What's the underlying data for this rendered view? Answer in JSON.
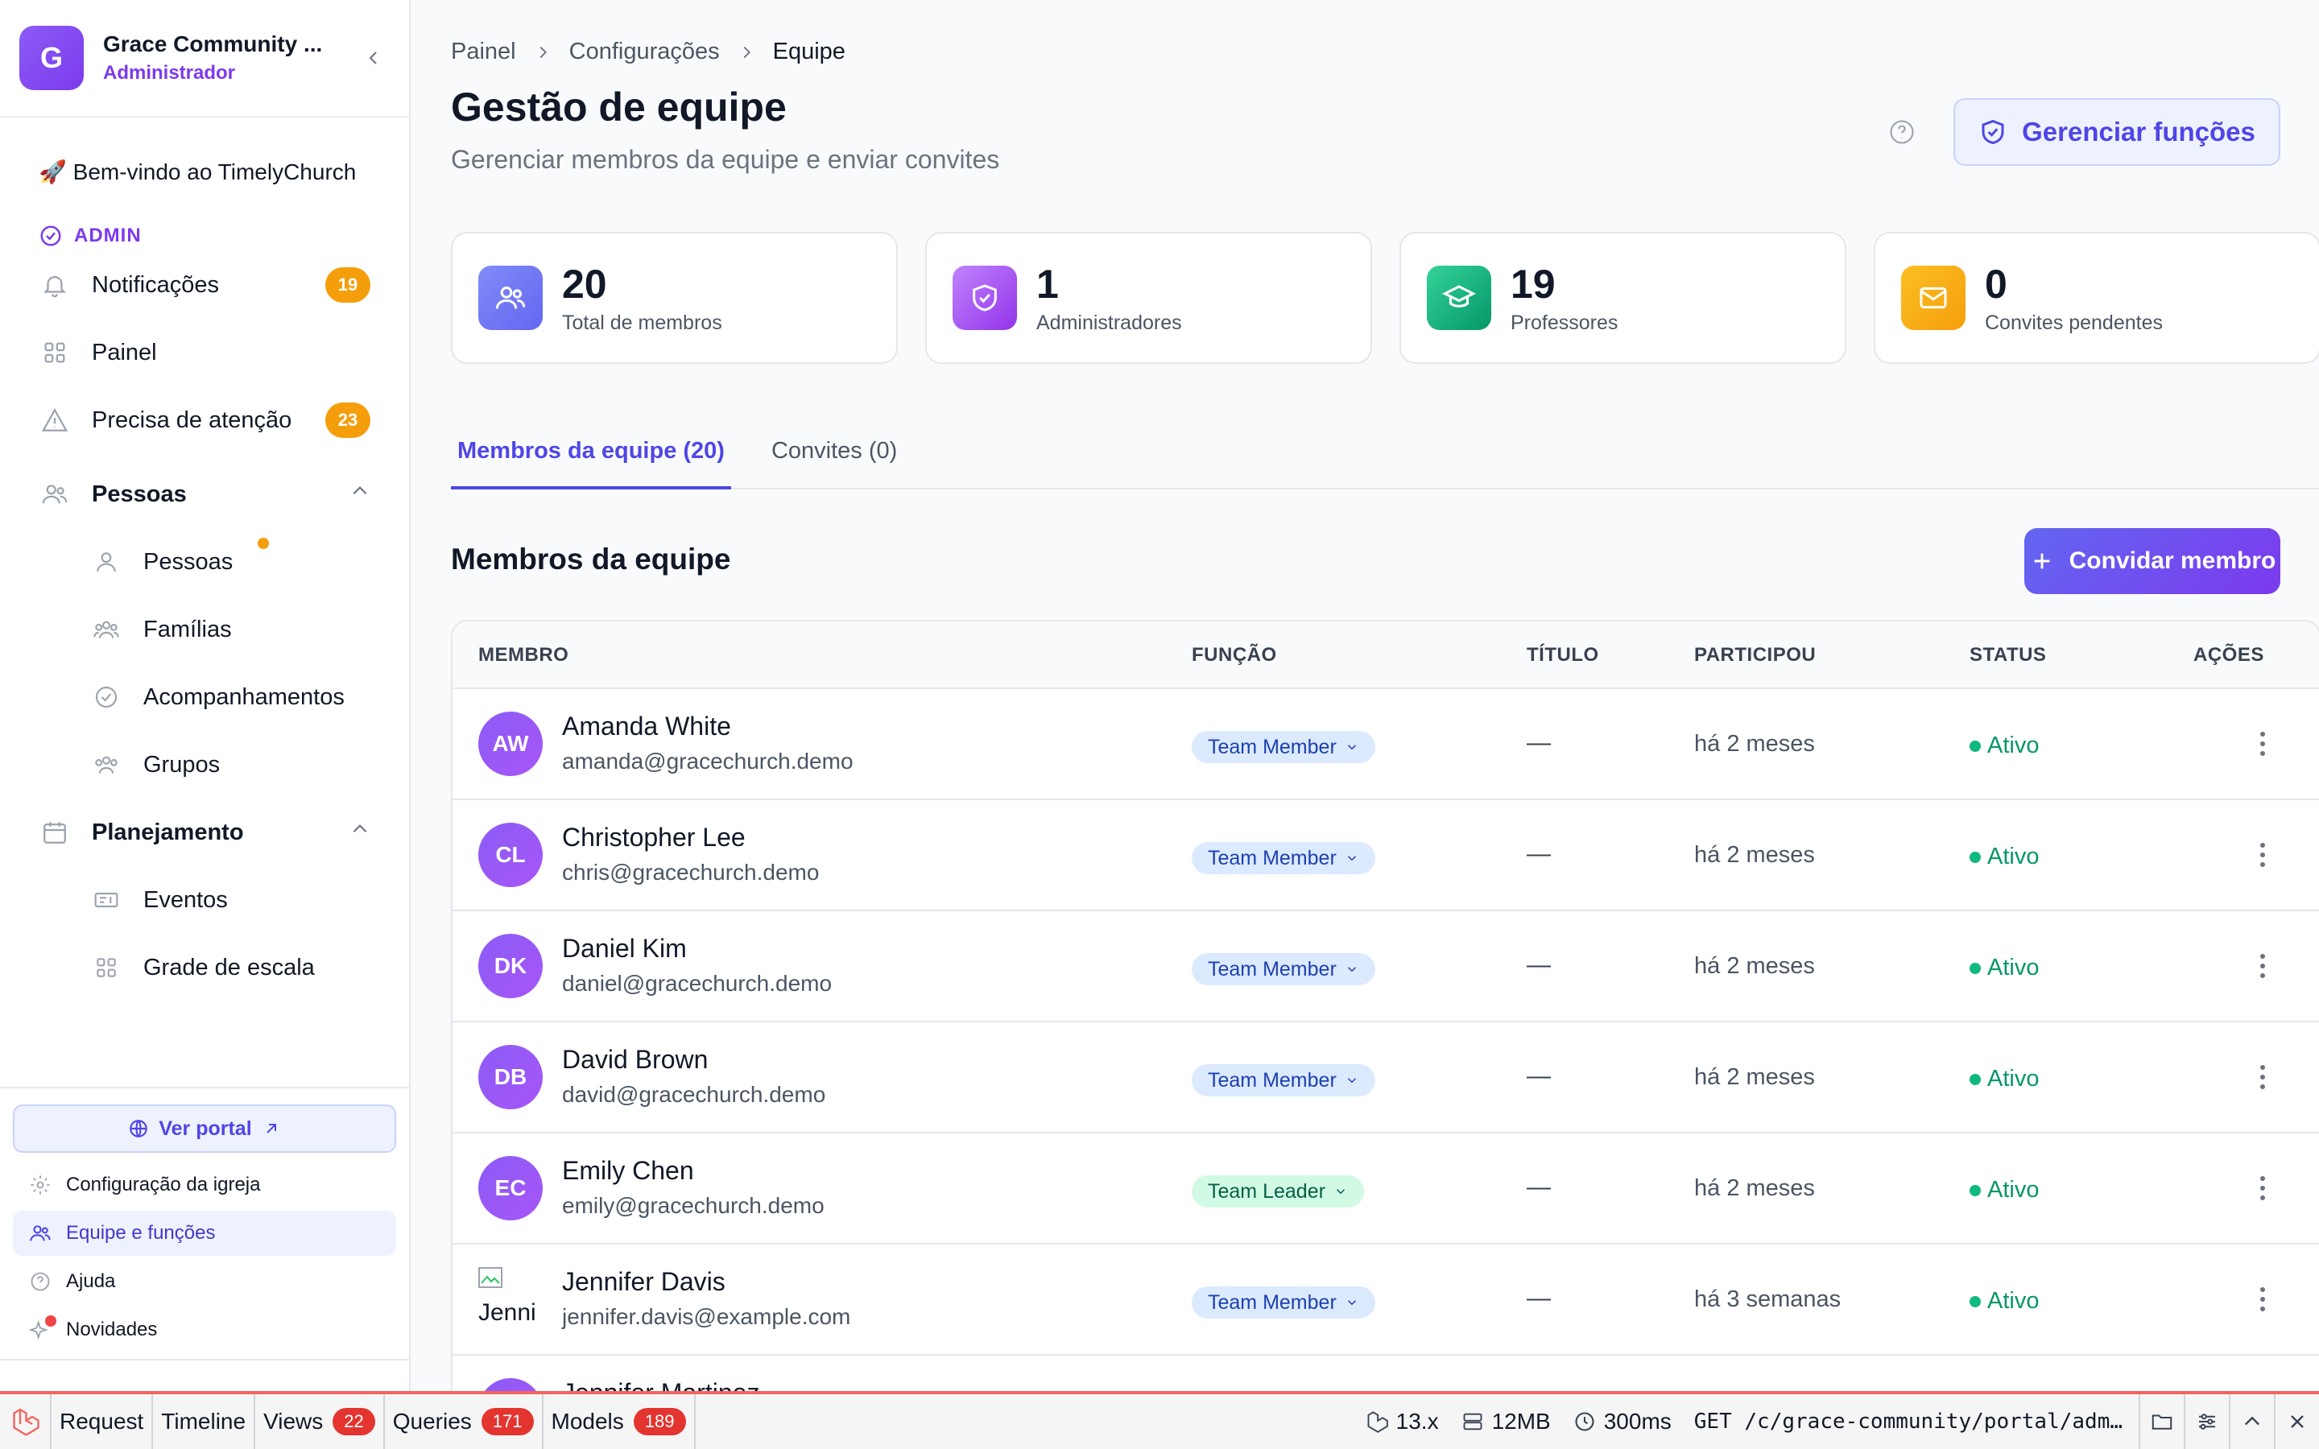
{
  "sidebar": {
    "org_initial": "G",
    "org_name": "Grace Community ...",
    "org_role": "Administrador",
    "welcome": "🚀 Bem-vindo ao TimelyChurch",
    "admin_label": "ADMIN",
    "items": [
      {
        "label": "Notificações",
        "badge": "19"
      },
      {
        "label": "Painel"
      },
      {
        "label": "Precisa de atenção",
        "badge": "23"
      }
    ],
    "people_section": "Pessoas",
    "people_items": [
      "Pessoas",
      "Famílias",
      "Acompanhamentos",
      "Grupos"
    ],
    "planning_section": "Planejamento",
    "planning_items": [
      "Eventos",
      "Grade de escala"
    ],
    "portal_button": "Ver portal",
    "bottom_items": [
      "Configuração da igreja",
      "Equipe e funções",
      "Ajuda",
      "Novidades"
    ]
  },
  "header": {
    "breadcrumb": [
      "Painel",
      "Configurações",
      "Equipe"
    ],
    "title": "Gestão de equipe",
    "subtitle": "Gerenciar membros da equipe e enviar convites",
    "roles_button": "Gerenciar funções"
  },
  "stats": [
    {
      "value": "20",
      "label": "Total de membros",
      "color": "#6366f1"
    },
    {
      "value": "1",
      "label": "Administradores",
      "color": "#a855f7"
    },
    {
      "value": "19",
      "label": "Professores",
      "color": "#10b981"
    },
    {
      "value": "0",
      "label": "Convites pendentes",
      "color": "#f59e0b"
    }
  ],
  "tabs": [
    "Membros da equipe (20)",
    "Convites (0)"
  ],
  "section_title": "Membros da equipe",
  "invite_button": "Convidar membro",
  "table": {
    "columns": [
      "MEMBRO",
      "FUNÇÃO",
      "TÍTULO",
      "PARTICIPOU",
      "STATUS",
      "AÇÕES"
    ],
    "rows": [
      {
        "initials": "AW",
        "name": "Amanda White",
        "email": "amanda@gracechurch.demo",
        "role": "Team Member",
        "title": "—",
        "joined": "há 2 meses",
        "status": "Ativo"
      },
      {
        "initials": "CL",
        "name": "Christopher Lee",
        "email": "chris@gracechurch.demo",
        "role": "Team Member",
        "title": "—",
        "joined": "há 2 meses",
        "status": "Ativo"
      },
      {
        "initials": "DK",
        "name": "Daniel Kim",
        "email": "daniel@gracechurch.demo",
        "role": "Team Member",
        "title": "—",
        "joined": "há 2 meses",
        "status": "Ativo"
      },
      {
        "initials": "DB",
        "name": "David Brown",
        "email": "david@gracechurch.demo",
        "role": "Team Member",
        "title": "—",
        "joined": "há 2 meses",
        "status": "Ativo"
      },
      {
        "initials": "EC",
        "name": "Emily Chen",
        "email": "emily@gracechurch.demo",
        "role": "Team Leader",
        "title": "—",
        "joined": "há 2 meses",
        "status": "Ativo"
      },
      {
        "initials": "Jenni",
        "name": "Jennifer Davis",
        "email": "jennifer.davis@example.com",
        "role": "Team Member",
        "title": "—",
        "joined": "há 3 semanas",
        "status": "Ativo"
      },
      {
        "initials": "",
        "name": "Jennifer Martinez",
        "email": "",
        "role": "",
        "title": "",
        "joined": "",
        "status": ""
      }
    ]
  },
  "debugbar": {
    "tabs": [
      {
        "label": "Request"
      },
      {
        "label": "Timeline"
      },
      {
        "label": "Views",
        "badge": "22"
      },
      {
        "label": "Queries",
        "badge": "171"
      },
      {
        "label": "Models",
        "badge": "189"
      }
    ],
    "version": "13.x",
    "memory": "12MB",
    "time": "300ms",
    "route": "GET /c/grace-community/portal/adm…"
  }
}
